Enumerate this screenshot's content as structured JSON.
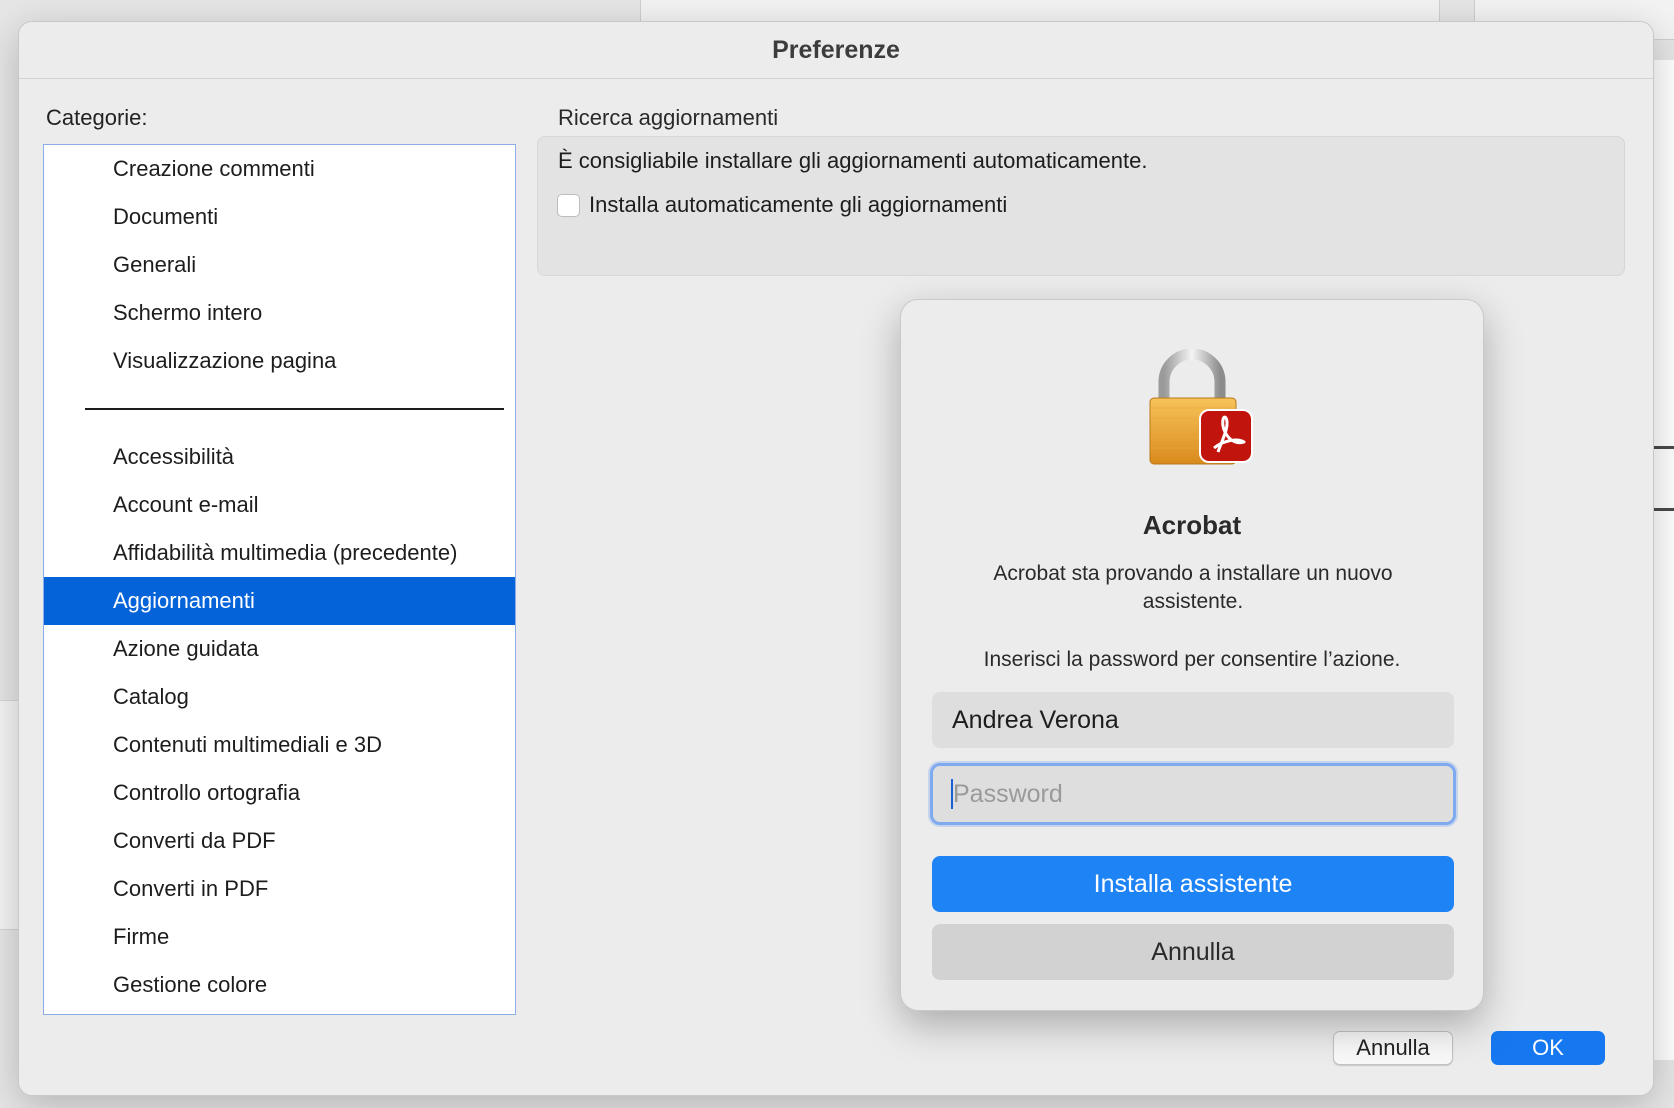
{
  "window": {
    "title": "Preferenze"
  },
  "categories": {
    "label": "Categorie:",
    "top_group": [
      "Creazione commenti",
      "Documenti",
      "Generali",
      "Schermo intero",
      "Visualizzazione pagina"
    ],
    "bottom_group": [
      "Accessibilità",
      "Account e-mail",
      "Affidabilità multimedia (precedente)",
      "Aggiornamenti",
      "Azione guidata",
      "Catalog",
      "Contenuti multimediali e 3D",
      "Controllo ortografia",
      "Converti da PDF",
      "Converti in PDF",
      "Firme",
      "Gestione colore"
    ],
    "selected": "Aggiornamenti"
  },
  "updates": {
    "section_title": "Ricerca aggiornamenti",
    "recommendation": "È consigliabile installare gli aggiornamenti automaticamente.",
    "auto_install_label": "Installa automaticamente gli aggiornamenti",
    "auto_install_checked": false
  },
  "footer": {
    "cancel_label": "Annulla",
    "ok_label": "OK"
  },
  "auth_dialog": {
    "icon": "lock-acrobat-icon",
    "title": "Acrobat",
    "message": "Acrobat sta provando a installare un nuovo assistente.",
    "hint": "Inserisci la password per consentire l’azione.",
    "username_value": "Andrea Verona",
    "password_placeholder": "Password",
    "install_label": "Installa assistente",
    "cancel_label": "Annulla"
  },
  "colors": {
    "selection": "#0463d9",
    "primary_button": "#1e83f5",
    "acrobat_red": "#c1140c"
  }
}
